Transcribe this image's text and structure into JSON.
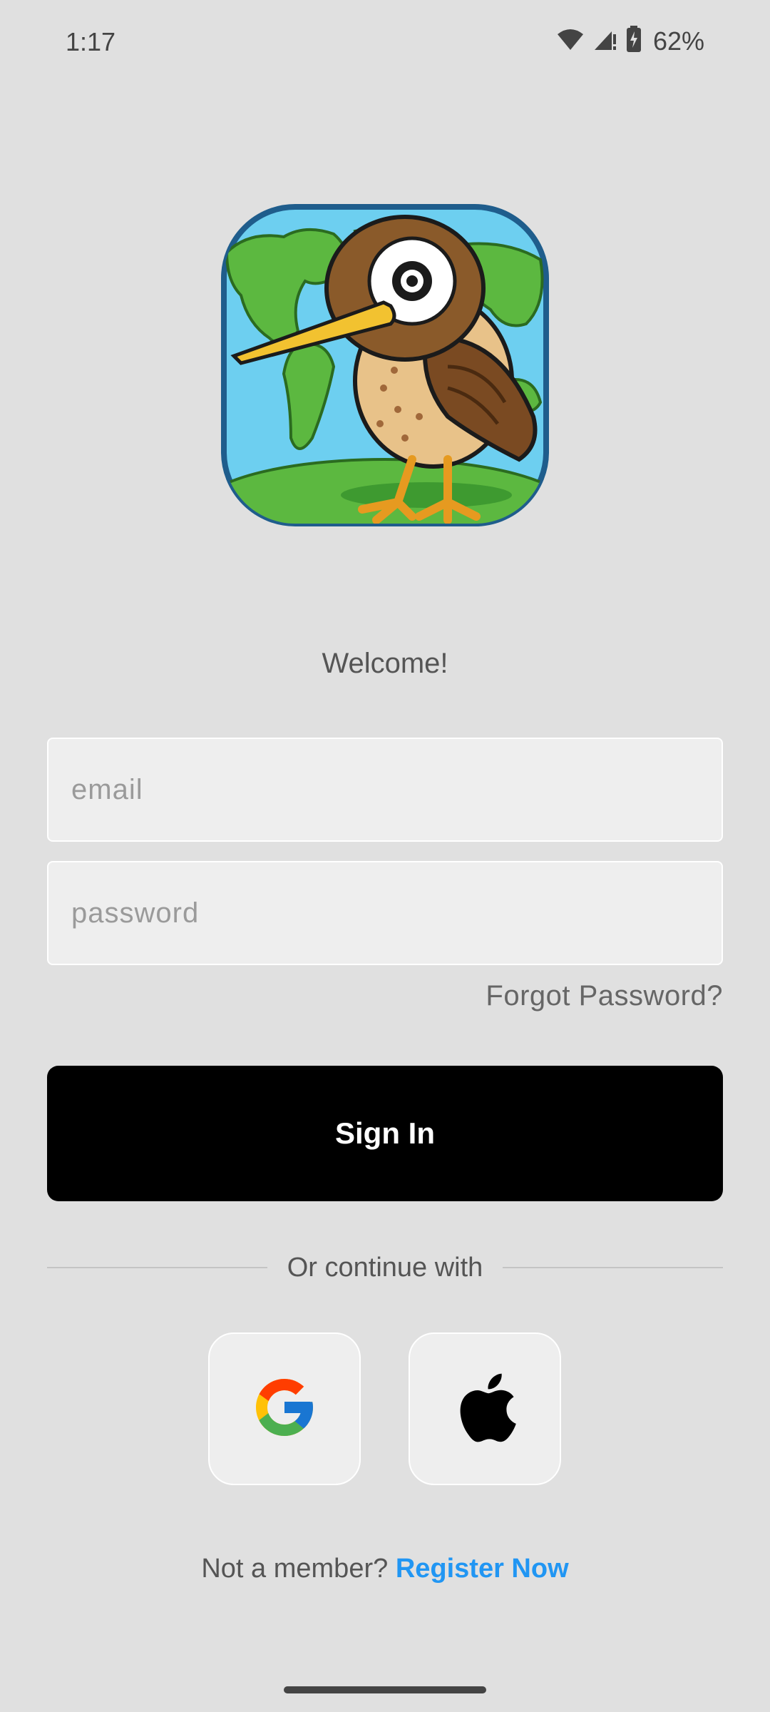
{
  "status_bar": {
    "time": "1:17",
    "battery_percent": "62%",
    "icons": [
      "wifi-icon",
      "cell-signal-icon",
      "battery-charging-icon"
    ]
  },
  "logo": {
    "icon": "bird-globe-logo"
  },
  "welcome_text": "Welcome!",
  "email": {
    "placeholder": "email",
    "value": ""
  },
  "password": {
    "placeholder": "password",
    "value": ""
  },
  "forgot_password_label": "Forgot Password?",
  "sign_in_label": "Sign In",
  "divider_text": "Or continue with",
  "social": {
    "google_icon": "google-icon",
    "apple_icon": "apple-icon"
  },
  "register": {
    "prompt": "Not a member?",
    "link_label": "Register Now"
  },
  "colors": {
    "background": "#e0e0e0",
    "accent": "#2196f3",
    "primary_button": "#000000"
  }
}
